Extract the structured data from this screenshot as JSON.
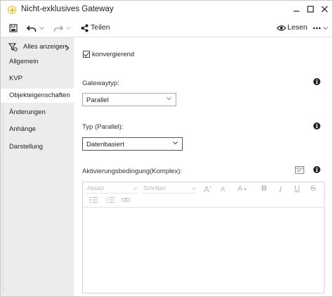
{
  "window": {
    "title": "Nicht-exklusives Gateway",
    "controls": [
      "minimize-icon",
      "maximize-icon",
      "close-icon"
    ]
  },
  "toolbar": {
    "save_icon": "save-icon",
    "undo_icon": "undo-icon",
    "redo_icon": "redo-icon",
    "share_label": "Teilen",
    "read_label": "Lesen",
    "more_icon": "more-icon"
  },
  "sidebar": {
    "show_all_label": "Alles anzeigen",
    "items": [
      {
        "label": "Allgemein",
        "active": false
      },
      {
        "label": "KVP",
        "active": false
      },
      {
        "label": "Objekteigenschaften",
        "active": true
      },
      {
        "label": "Änderungen",
        "active": false
      },
      {
        "label": "Anhänge",
        "active": false
      },
      {
        "label": "Darstellung",
        "active": false
      }
    ]
  },
  "form": {
    "convergent_label": "konvergierend",
    "convergent_checked": true,
    "gateway_type_label": "Gatewaytyp:",
    "gateway_type_value": "Parallel",
    "type_parallel_label": "Typ (Parallel):",
    "type_parallel_value": "Datenbasiert",
    "activation_label": "Aktivierungsbedingung(Komplex):"
  },
  "editor": {
    "paragraph_placeholder": "Absatz",
    "font_placeholder": "Schriftart",
    "tools": [
      "font-size-increase-icon",
      "font-size-decrease-icon",
      "font-color-icon",
      "bold-icon",
      "italic-icon",
      "underline-icon",
      "strikethrough-icon",
      "bullet-list-icon",
      "numbered-list-icon",
      "link-icon"
    ]
  },
  "colors": {
    "sidebar_bg": "#ececec",
    "active_item_bg": "#ffffff",
    "logo_accent": "#e8c24a"
  }
}
